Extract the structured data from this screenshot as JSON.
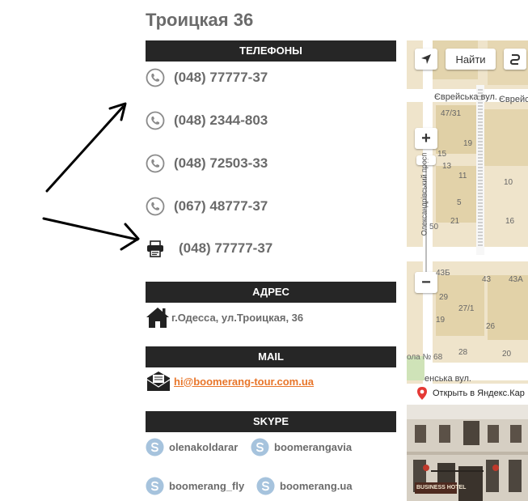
{
  "page": {
    "title": "Троицкая 36"
  },
  "phones_section": {
    "header": "ТЕЛЕФОНЫ",
    "items": [
      {
        "icon": "phone-icon",
        "number": "(048) 77777-37"
      },
      {
        "icon": "phone-icon",
        "number": "(048) 2344-803"
      },
      {
        "icon": "phone-icon",
        "number": "(048) 72503-33"
      },
      {
        "icon": "phone-icon",
        "number": "(067) 48777-37"
      },
      {
        "icon": "fax-icon",
        "number": "(048) 77777-37"
      }
    ]
  },
  "address_section": {
    "header": "АДРЕС",
    "icon": "home-icon",
    "text": "г.Одесса, ул.Троицкая, 36"
  },
  "mail_section": {
    "header": "MAIL",
    "icon": "envelope-icon",
    "email": "hi@boomerang-tour.com.ua"
  },
  "skype_section": {
    "header": "SKYPE",
    "items": [
      {
        "icon": "skype-icon",
        "name": "olenakoldarar"
      },
      {
        "icon": "skype-icon",
        "name": "boomerangavia"
      },
      {
        "icon": "skype-icon",
        "name": "boomerang_fly"
      },
      {
        "icon": "skype-icon",
        "name": "boomerang.ua"
      }
    ]
  },
  "map": {
    "find_button": "Найти",
    "zoom_in": "+",
    "zoom_out": "−",
    "open_link": "Открыть в Яндекс.Кар",
    "streets": [
      "Єврейська вул.",
      "Єврейськ",
      "Олександрівський просп",
      "енська вул."
    ],
    "building_numbers": [
      "47/31",
      "19",
      "15",
      "13",
      "11",
      "10",
      "5",
      "50",
      "16",
      "21",
      "43Б",
      "43",
      "43А",
      "29",
      "27/1",
      "19",
      "26",
      "28",
      "20"
    ],
    "school_label": "ола № 68"
  },
  "hotel_photo": {
    "sign": "BUSINESS HOTEL"
  },
  "colors": {
    "header_bg": "#262626",
    "link": "#e8762b",
    "text": "#6b6b6b",
    "skype": "#a6c3dd"
  }
}
